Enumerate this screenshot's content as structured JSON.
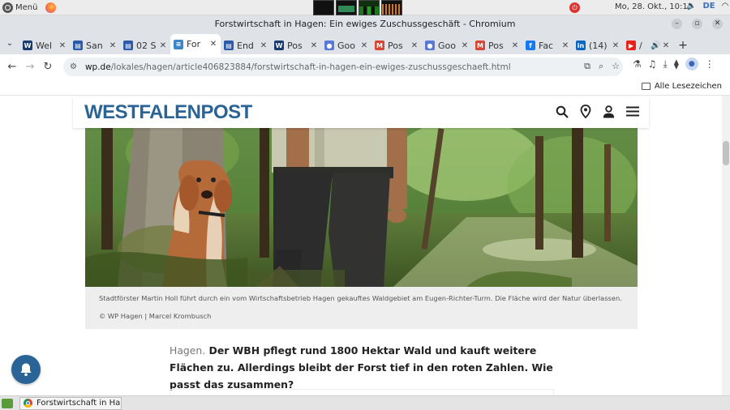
{
  "system": {
    "menu_label": "Menü",
    "datetime": "Mo, 28. Okt., 10:10",
    "lang": "DE"
  },
  "window": {
    "title": "Forstwirtschaft in Hagen: Ein ewiges Zuschussgeschäft - Chromium"
  },
  "tabs": [
    {
      "label": "Wel",
      "icon": "westfalenpost-icon",
      "color": "#1a3b6e"
    },
    {
      "label": "San",
      "icon": "doc-icon",
      "color": "#2a5aa8"
    },
    {
      "label": "02 S",
      "icon": "doc-icon",
      "color": "#2a5aa8"
    },
    {
      "label": "For",
      "icon": "stack-icon",
      "color": "#3a86c8",
      "active": true
    },
    {
      "label": "End",
      "icon": "doc-icon",
      "color": "#2a5aa8"
    },
    {
      "label": "Pos",
      "icon": "westfalenpost-icon",
      "color": "#1a3b6e"
    },
    {
      "label": "Goo",
      "icon": "user-icon",
      "color": "#5a78d6"
    },
    {
      "label": "Pos",
      "icon": "gmail-icon",
      "color": "#d64536"
    },
    {
      "label": "Goo",
      "icon": "user-icon",
      "color": "#5a78d6"
    },
    {
      "label": "Pos",
      "icon": "gmail-icon",
      "color": "#d64536"
    },
    {
      "label": "Fac",
      "icon": "facebook-icon",
      "color": "#1877f2"
    },
    {
      "label": "(14)",
      "icon": "linkedin-icon",
      "color": "#0a66c2"
    },
    {
      "label": "/",
      "icon": "youtube-icon",
      "color": "#e62117"
    }
  ],
  "address": {
    "host": "wp.de",
    "path": "/lokales/hagen/article406823884/forstwirtschaft-in-hagen-ein-ewiges-zuschussgeschaeft.html"
  },
  "bookmarks": {
    "all_label": "Alle Lesezeichen"
  },
  "site": {
    "logo": "WESTFALENPOST"
  },
  "article": {
    "caption": "Stadtförster Martin Holl führt durch ein vom Wirtschaftsbetrieb Hagen gekauftes Waldgebiet am Eugen-Richter-Turm. Die Fläche wird der Natur überlassen.",
    "credit": "© WP Hagen | Marcel Krombusch",
    "teaser_location": "Hagen.",
    "teaser_text": "Der WBH pflegt rund 1800 Hektar Wald und kauft weitere Flächen zu. Allerdings bleibt der Forst tief in den roten Zahlen. Wie passt das zusammen?"
  },
  "taskbar": {
    "task_label": "Forstwirtschaft in Ha..."
  },
  "colors": {
    "brand": "#2a6496",
    "caption_bg": "#eeeeee"
  }
}
